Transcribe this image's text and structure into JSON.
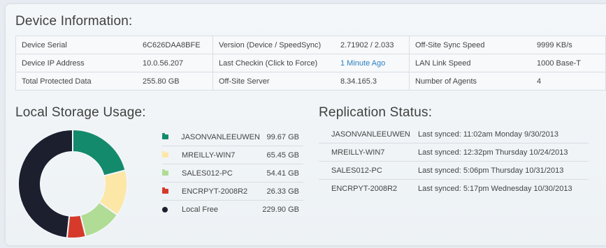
{
  "device_info": {
    "heading": "Device Information:",
    "rows": [
      [
        "Device Serial",
        "6C626DAA8BFE",
        "Version (Device / SpeedSync)",
        "2.71902 / 2.033",
        "Off-Site Sync Speed",
        "9999 KB/s"
      ],
      [
        "Device IP Address",
        "10.0.56.207",
        "Last Checkin (Click to Force)",
        "1 Minute Ago",
        "LAN Link Speed",
        "1000 Base-T"
      ],
      [
        "Total Protected Data",
        "255.80 GB",
        "Off-Site Server",
        "8.34.165.3",
        "Number of Agents",
        "4"
      ]
    ]
  },
  "local_storage": {
    "heading": "Local Storage Usage:",
    "items": [
      {
        "name": "JASONVANLEEUWEN",
        "value": "99.67 GB",
        "color": "#138a6c",
        "icon": "folder-icon"
      },
      {
        "name": "MREILLY-WIN7",
        "value": "65.45 GB",
        "color": "#fde7a6",
        "icon": "folder-icon"
      },
      {
        "name": "SALES012-PC",
        "value": "54.41 GB",
        "color": "#b0dc95",
        "icon": "folder-icon"
      },
      {
        "name": "ENCRPYT-2008R2",
        "value": "26.33 GB",
        "color": "#d63a2a",
        "icon": "folder-icon"
      },
      {
        "name": "Local Free",
        "value": "229.90 GB",
        "color": "#1b1f2e",
        "icon": "circle-icon"
      }
    ]
  },
  "replication": {
    "heading": "Replication Status:",
    "items": [
      {
        "name": "JASONVANLEEUWEN",
        "status": "Last synced: 11:02am Monday 9/30/2013"
      },
      {
        "name": "MREILLY-WIN7",
        "status": "Last synced: 12:32pm Thursday 10/24/2013"
      },
      {
        "name": "SALES012-PC",
        "status": "Last synced: 5:06pm Thursday 10/31/2013"
      },
      {
        "name": "ENCRPYT-2008R2",
        "status": "Last synced: 5:17pm Wednesday 10/30/2013"
      }
    ]
  }
}
